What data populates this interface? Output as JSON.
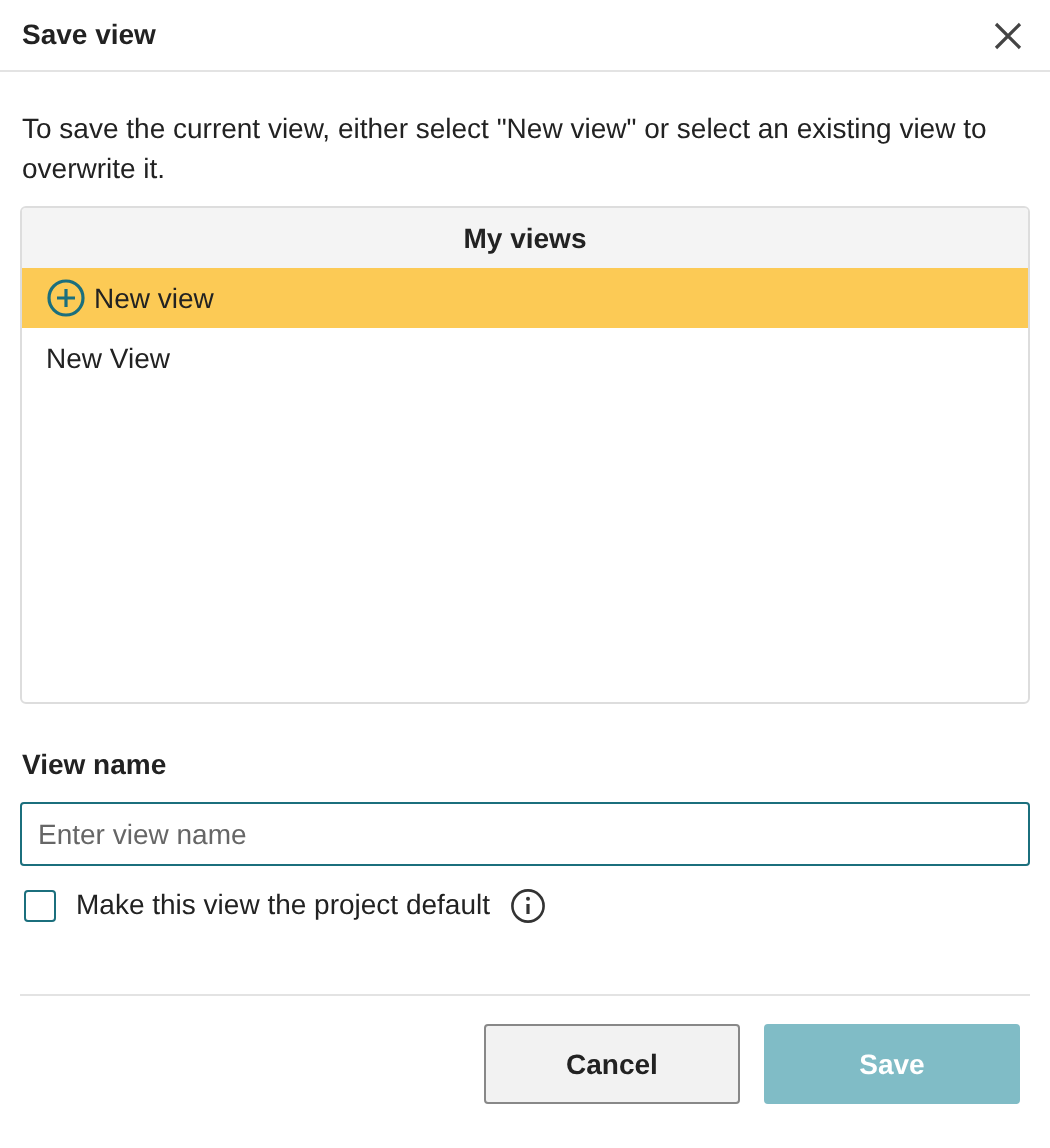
{
  "dialog": {
    "title": "Save view",
    "description": "To save the current view, either select \"New view\" or select an existing view to overwrite it."
  },
  "views_list": {
    "header": "My views",
    "items": [
      {
        "kind": "new",
        "label": "New view",
        "selected": true
      },
      {
        "kind": "existing",
        "label": "New View",
        "selected": false
      }
    ]
  },
  "view_name": {
    "label": "View name",
    "placeholder": "Enter view name",
    "focused": true
  },
  "default_checkbox": {
    "label": "Make this view the project default",
    "checked": false
  },
  "buttons": [
    {
      "kind": "secondary",
      "label": "Cancel",
      "disabled": false
    },
    {
      "kind": "primary",
      "label": "Save",
      "disabled": true
    }
  ]
}
